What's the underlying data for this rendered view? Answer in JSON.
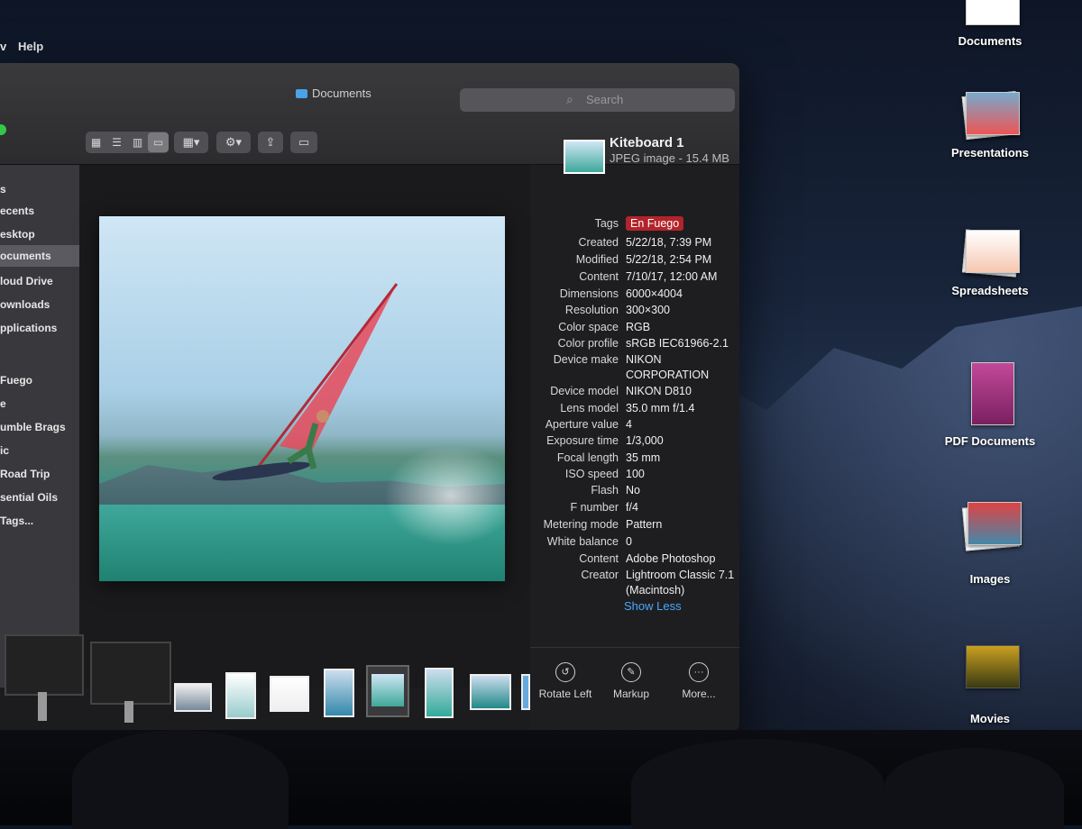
{
  "menubar": {
    "items": [
      "v",
      "Help"
    ]
  },
  "window": {
    "title": "Documents",
    "search_placeholder": "Search"
  },
  "toolbar": {
    "view_buttons": [
      "icon-view-icon",
      "list-view-icon",
      "column-view-icon",
      "gallery-view-icon"
    ],
    "group_button": "group-icon",
    "action_button": "gear-icon",
    "share_button": "share-icon",
    "tags_button": "tag-icon"
  },
  "sidebar": {
    "items": [
      {
        "label": "s"
      },
      {
        "label": "ecents"
      },
      {
        "label": "esktop"
      },
      {
        "label": "ocuments"
      },
      {
        "label": "loud Drive"
      },
      {
        "label": "ownloads"
      },
      {
        "label": "pplications"
      },
      {
        "label": "Fuego"
      },
      {
        "label": "e"
      },
      {
        "label": "umble Brags"
      },
      {
        "label": "ic"
      },
      {
        "label": "Road Trip"
      },
      {
        "label": "sential Oils"
      },
      {
        "label": "Tags..."
      }
    ]
  },
  "file": {
    "name": "Kiteboard 1",
    "kind": "JPEG image - 15.4 MB"
  },
  "metadata": [
    {
      "label": "Tags",
      "value": "En Fuego",
      "tag": true
    },
    {
      "label": "Created",
      "value": "5/22/18, 7:39 PM"
    },
    {
      "label": "Modified",
      "value": "5/22/18, 2:54 PM"
    },
    {
      "label": "Content",
      "value": "7/10/17, 12:00 AM"
    },
    {
      "label": "Dimensions",
      "value": "6000×4004"
    },
    {
      "label": "Resolution",
      "value": "300×300"
    },
    {
      "label": "Color space",
      "value": "RGB"
    },
    {
      "label": "Color profile",
      "value": "sRGB IEC61966-2.1"
    },
    {
      "label": "Device make",
      "value": "NIKON",
      "value2": "CORPORATION"
    },
    {
      "label": "Device model",
      "value": "NIKON D810"
    },
    {
      "label": "Lens model",
      "value": "35.0 mm f/1.4"
    },
    {
      "label": "Aperture value",
      "value": "4"
    },
    {
      "label": "Exposure time",
      "value": "1/3,000"
    },
    {
      "label": "Focal length",
      "value": "35 mm"
    },
    {
      "label": "ISO speed",
      "value": "100"
    },
    {
      "label": "Flash",
      "value": "No"
    },
    {
      "label": "F number",
      "value": "f/4"
    },
    {
      "label": "Metering mode",
      "value": "Pattern"
    },
    {
      "label": "White balance",
      "value": "0"
    },
    {
      "label": "Content",
      "value": "Adobe Photoshop"
    },
    {
      "label": "Creator",
      "value": "Lightroom Classic 7.1",
      "value2": "(Macintosh)"
    }
  ],
  "show_less": "Show Less",
  "actions": [
    {
      "label": "Rotate Left",
      "icon": "rotate-left-icon"
    },
    {
      "label": "Markup",
      "icon": "markup-icon"
    },
    {
      "label": "More...",
      "icon": "more-icon"
    }
  ],
  "desktop": {
    "items": [
      {
        "label": "Documents"
      },
      {
        "label": "Presentations"
      },
      {
        "label": "Spreadsheets"
      },
      {
        "label": "PDF Documents"
      },
      {
        "label": "Images"
      },
      {
        "label": "Movies"
      }
    ]
  },
  "colors": {
    "tag_red": "#b3232b",
    "link_blue": "#4aa8ff",
    "folder_blue": "#4aa3e8"
  }
}
